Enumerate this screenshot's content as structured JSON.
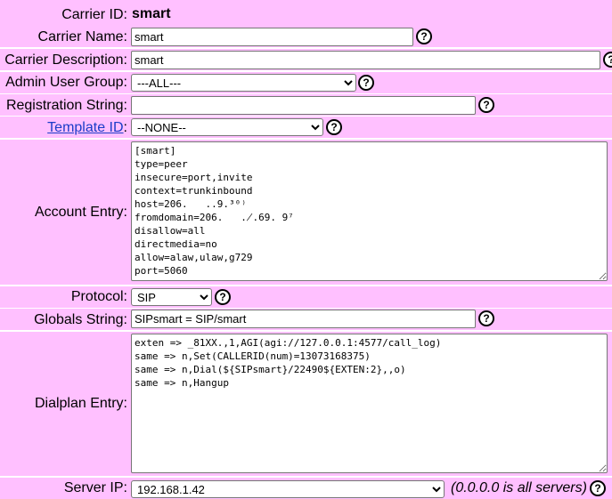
{
  "page": {
    "top_text": ""
  },
  "fields": {
    "carrier_id": {
      "label": "Carrier ID:",
      "value": "smart"
    },
    "carrier_name": {
      "label": "Carrier Name:",
      "value": "smart"
    },
    "carrier_description": {
      "label": "Carrier Description:",
      "value": "smart"
    },
    "admin_user_group": {
      "label": "Admin User Group:",
      "value": "---ALL---"
    },
    "registration_string": {
      "label": "Registration String:",
      "value": ""
    },
    "template_id": {
      "label": "Template ID",
      "colon": ":",
      "value": "--NONE--"
    },
    "account_entry": {
      "label": "Account Entry:",
      "value": "[smart]\ntype=peer\ninsecure=port,invite\ncontext=trunkinbound\nhost=206.   ..9.³⁰⁾\nfromdomain=206.   .̸.69. 9⁷\ndisallow=all\ndirectmedia=no\nallow=alaw,ulaw,g729\nport=5060"
    },
    "protocol": {
      "label": "Protocol:",
      "value": "SIP"
    },
    "globals_string": {
      "label": "Globals String:",
      "value": "SIPsmart = SIP/smart"
    },
    "dialplan_entry": {
      "label": "Dialplan Entry:",
      "value": "exten => _81XX.,1,AGI(agi://127.0.0.1:4577/call_log)\nsame => n,Set(CALLERID(num)=13073168375)\nsame => n,Dial(${SIPsmart}/22490${EXTEN:2},,o)\nsame => n,Hangup"
    },
    "server_ip": {
      "label": "Server IP:",
      "value": "192.168.1.42",
      "note": "(0.0.0.0 is all servers)"
    }
  },
  "help_symbol": "?",
  "colors": {
    "row_bg": "#FFC0FF",
    "link": "#1A3CC8"
  }
}
